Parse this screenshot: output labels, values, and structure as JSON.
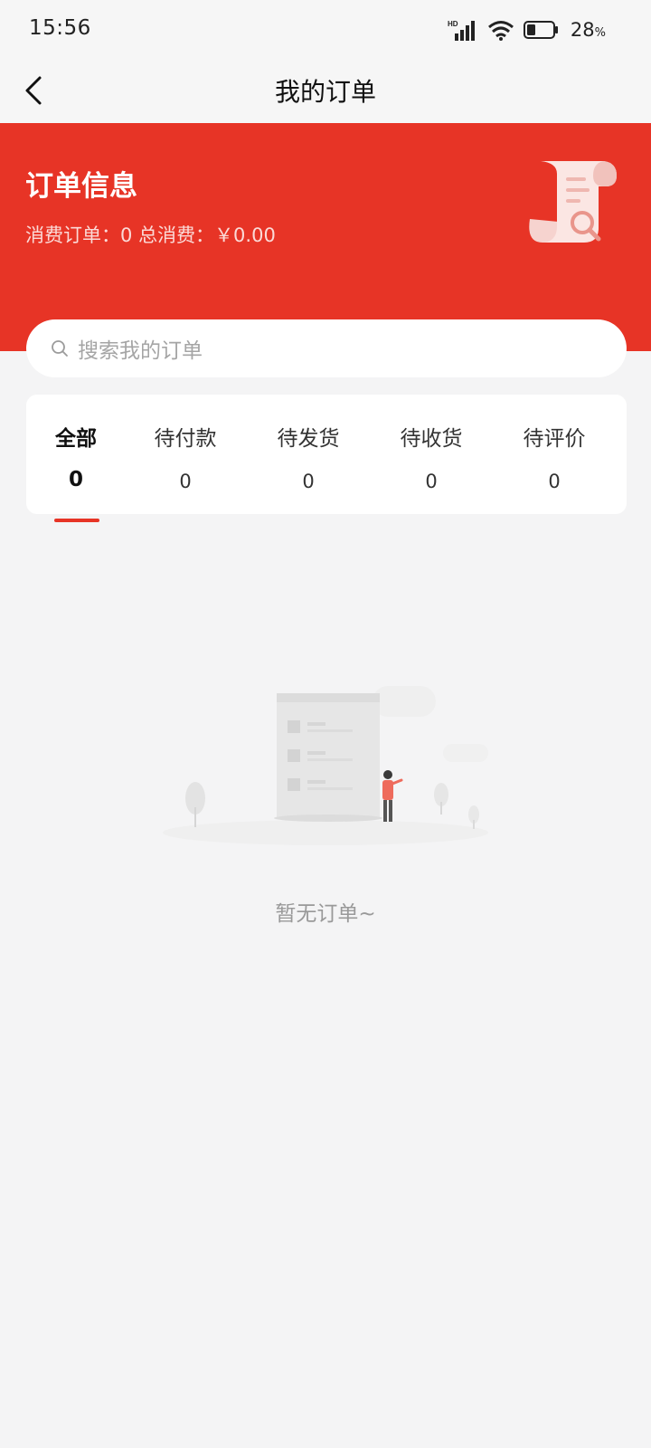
{
  "status_bar": {
    "time": "15:56",
    "network_label": "HD",
    "battery": "28",
    "battery_unit": "%"
  },
  "nav": {
    "title": "我的订单"
  },
  "banner": {
    "title": "订单信息",
    "orders_label": "消费订单：",
    "orders_count": "0",
    "total_label": "总消费：",
    "total_value": "￥0.00"
  },
  "search": {
    "placeholder": "搜索我的订单"
  },
  "tabs": [
    {
      "label": "全部",
      "count": "0",
      "active": true
    },
    {
      "label": "待付款",
      "count": "0",
      "active": false
    },
    {
      "label": "待发货",
      "count": "0",
      "active": false
    },
    {
      "label": "待收货",
      "count": "0",
      "active": false
    },
    {
      "label": "待评价",
      "count": "0",
      "active": false
    }
  ],
  "empty_state": {
    "message": "暂无订单~"
  },
  "colors": {
    "accent": "#e73426",
    "background": "#f4f4f5"
  }
}
